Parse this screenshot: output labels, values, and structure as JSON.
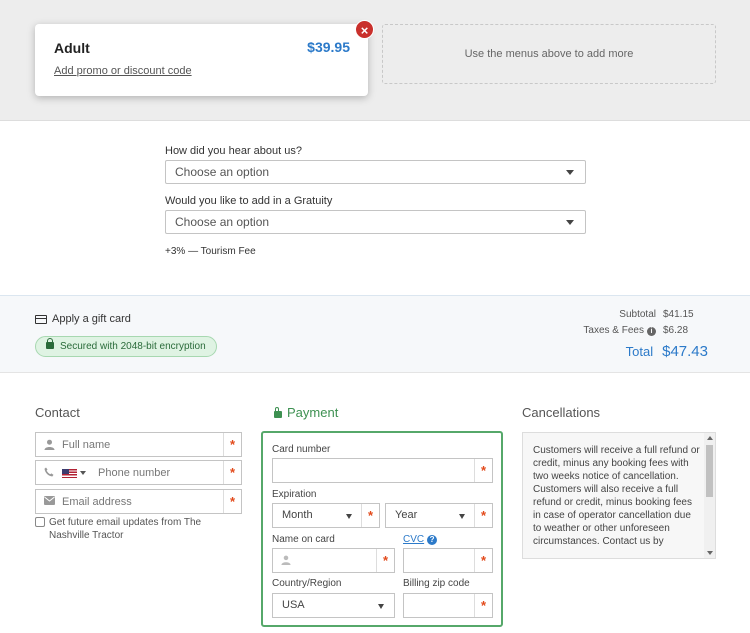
{
  "cart": {
    "item_name": "Adult",
    "item_price": "$39.95",
    "promo_link": "Add promo or discount code",
    "remove_symbol": "×",
    "add_more": "Use the menus above to add more"
  },
  "questions": {
    "hear_label": "How did you hear about us?",
    "hear_value": "Choose an option",
    "gratuity_label": "Would you like to add in a Gratuity",
    "gratuity_value": "Choose an option",
    "fee": "+3% — Tourism Fee"
  },
  "summary": {
    "gift_card": "Apply a gift card",
    "secure_badge": "Secured with 2048-bit encryption",
    "subtotal_label": "Subtotal",
    "subtotal_value": "$41.15",
    "taxes_label": "Taxes & Fees",
    "taxes_value": "$6.28",
    "total_label": "Total",
    "total_value": "$47.43"
  },
  "contact": {
    "heading": "Contact",
    "full_name_placeholder": "Full name",
    "phone_placeholder": "Phone number",
    "email_placeholder": "Email address",
    "updates_label": "Get future email updates from The Nashville Tractor",
    "required_symbol": "*"
  },
  "payment": {
    "heading": "Payment",
    "card_number_label": "Card number",
    "expiration_label": "Expiration",
    "month_value": "Month",
    "year_value": "Year",
    "name_on_card_label": "Name on card",
    "cvc_label": "CVC",
    "country_label": "Country/Region",
    "country_value": "USA",
    "zip_label": "Billing zip code"
  },
  "cancellations": {
    "heading": "Cancellations",
    "text": "Customers will receive a full refund or credit, minus any booking fees with two weeks notice of cancellation. Customers will also receive a full refund or credit, minus booking fees in case of operator cancellation due to weather or other unforeseen circumstances. Contact us by"
  },
  "colors": {
    "accent": "#2c7ac9",
    "required": "#e24a1b",
    "secure_green": "#56a86a",
    "remove_red": "#c9302c"
  }
}
